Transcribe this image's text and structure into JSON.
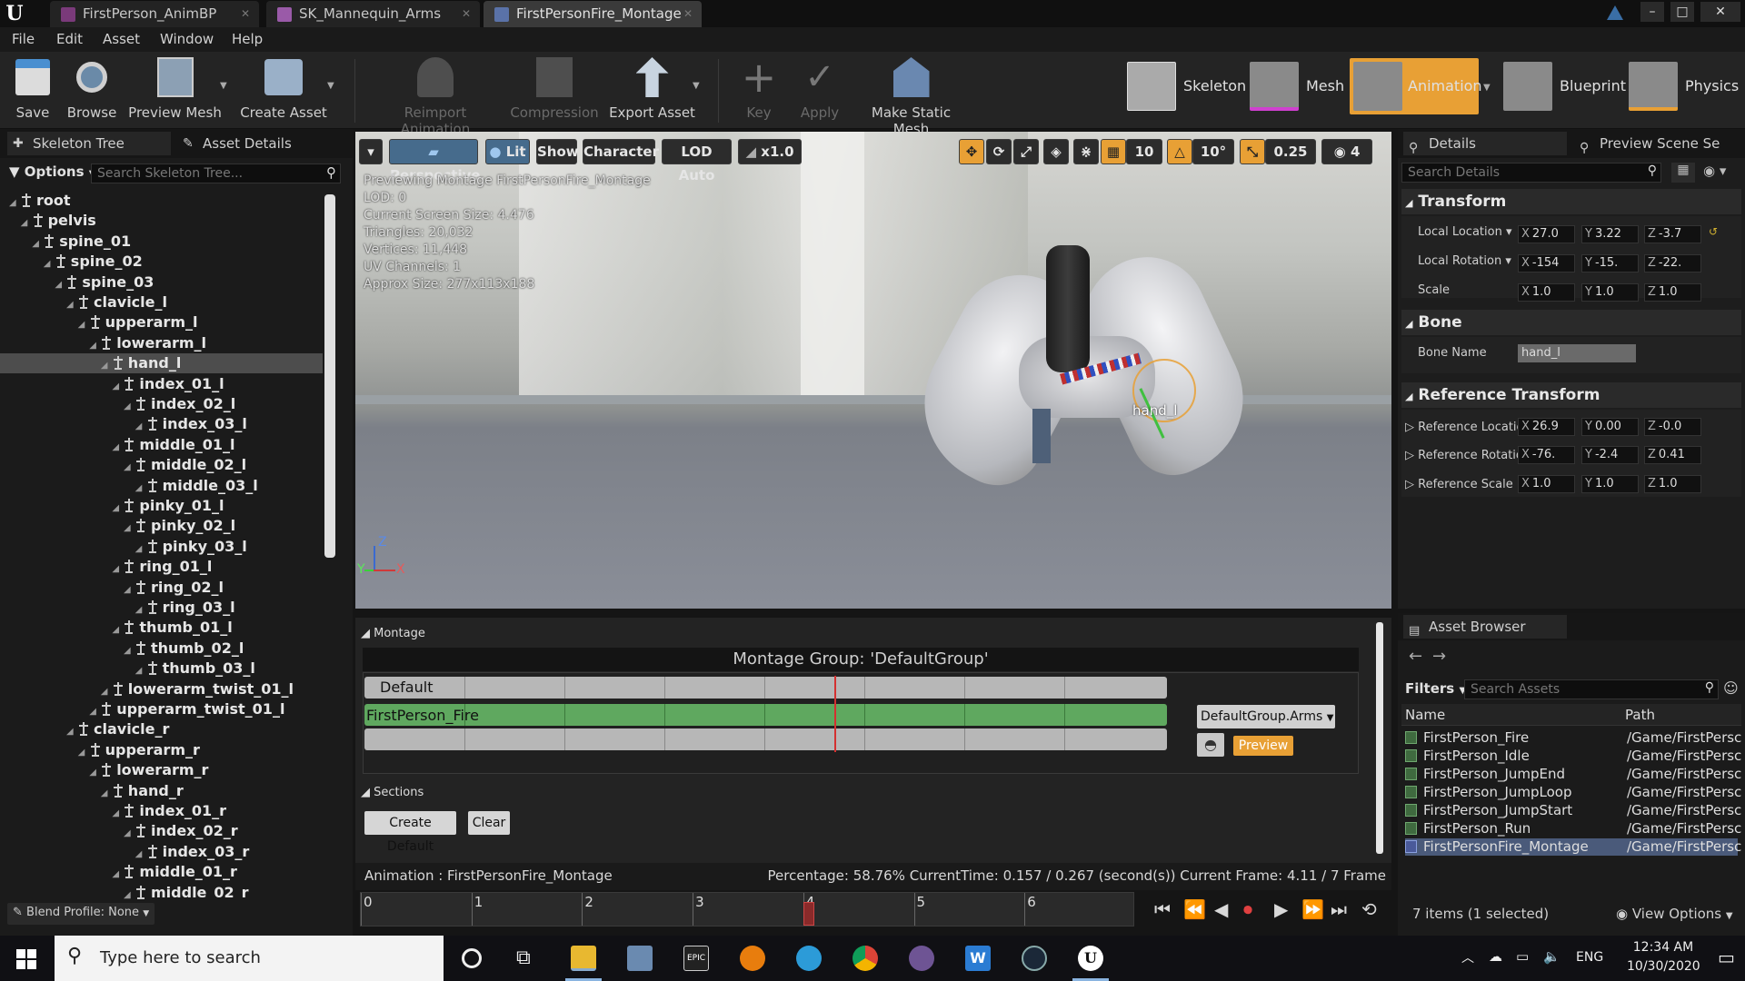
{
  "window": {
    "tabs": [
      {
        "label": "FirstPerson_AnimBP",
        "color": "#7a3a7a"
      },
      {
        "label": "SK_Mannequin_Arms",
        "color": "#9a5aa8"
      },
      {
        "label": "FirstPersonFire_Montage",
        "color": "#5a72a8"
      }
    ],
    "buttons": [
      "–",
      "□",
      "✕"
    ]
  },
  "menu": [
    "File",
    "Edit",
    "Asset",
    "Window",
    "Help"
  ],
  "toolbar": {
    "save": "Save",
    "browse": "Browse",
    "preview_mesh": "Preview Mesh",
    "create_asset": "Create Asset",
    "reimport": "Reimport Animation",
    "compression": "Compression",
    "export_asset": "Export Asset",
    "key": "Key",
    "apply": "Apply",
    "make_static_mesh": "Make Static Mesh",
    "modes": [
      "Skeleton",
      "Mesh",
      "Animation",
      "Blueprint",
      "Physics"
    ]
  },
  "left_panel": {
    "tabs": [
      "Skeleton Tree",
      "Asset Details"
    ],
    "options_label": "Options",
    "search_placeholder": "Search Skeleton Tree...",
    "selected_bone": "hand_l",
    "tree": [
      {
        "name": "root",
        "depth": 0
      },
      {
        "name": "pelvis",
        "depth": 1
      },
      {
        "name": "spine_01",
        "depth": 2
      },
      {
        "name": "spine_02",
        "depth": 3
      },
      {
        "name": "spine_03",
        "depth": 4
      },
      {
        "name": "clavicle_l",
        "depth": 5
      },
      {
        "name": "upperarm_l",
        "depth": 6
      },
      {
        "name": "lowerarm_l",
        "depth": 7
      },
      {
        "name": "hand_l",
        "depth": 8
      },
      {
        "name": "index_01_l",
        "depth": 9
      },
      {
        "name": "index_02_l",
        "depth": 10
      },
      {
        "name": "index_03_l",
        "depth": 11
      },
      {
        "name": "middle_01_l",
        "depth": 9
      },
      {
        "name": "middle_02_l",
        "depth": 10
      },
      {
        "name": "middle_03_l",
        "depth": 11
      },
      {
        "name": "pinky_01_l",
        "depth": 9
      },
      {
        "name": "pinky_02_l",
        "depth": 10
      },
      {
        "name": "pinky_03_l",
        "depth": 11
      },
      {
        "name": "ring_01_l",
        "depth": 9
      },
      {
        "name": "ring_02_l",
        "depth": 10
      },
      {
        "name": "ring_03_l",
        "depth": 11
      },
      {
        "name": "thumb_01_l",
        "depth": 9
      },
      {
        "name": "thumb_02_l",
        "depth": 10
      },
      {
        "name": "thumb_03_l",
        "depth": 11
      },
      {
        "name": "lowerarm_twist_01_l",
        "depth": 8
      },
      {
        "name": "upperarm_twist_01_l",
        "depth": 7
      },
      {
        "name": "clavicle_r",
        "depth": 5
      },
      {
        "name": "upperarm_r",
        "depth": 6
      },
      {
        "name": "lowerarm_r",
        "depth": 7
      },
      {
        "name": "hand_r",
        "depth": 8
      },
      {
        "name": "index_01_r",
        "depth": 9
      },
      {
        "name": "index_02_r",
        "depth": 10
      },
      {
        "name": "index_03_r",
        "depth": 11
      },
      {
        "name": "middle_01_r",
        "depth": 9
      },
      {
        "name": "middle_02_r",
        "depth": 10
      }
    ],
    "blend_profile": "Blend Profile: None"
  },
  "viewport": {
    "perspective": "Perspective",
    "lit": "Lit",
    "show": "Show",
    "character": "Character",
    "lod": "LOD Auto",
    "speed": "x1.0",
    "grid_snap": "10",
    "rot_snap": "10°",
    "scale_snap": "0.25",
    "cam_speed": "4",
    "stats": [
      "Previewing Montage FirstPersonFire_Montage",
      "LOD: 0",
      "Current Screen Size: 4.476",
      "Triangles: 20,032",
      "Vertices: 11,448",
      "UV Channels: 1",
      "Approx Size: 277x113x188"
    ],
    "bone_label": "hand_l",
    "axis_z": "Z",
    "axis_x": "X",
    "axis_y": "Y"
  },
  "montage": {
    "header": "Montage",
    "group_title": "Montage Group: 'DefaultGroup'",
    "default_label": "Default",
    "clip_label": "FirstPerson_Fire",
    "slot_dropdown": "DefaultGroup.Arms",
    "preview": "Preview",
    "sections_header": "Sections",
    "create_default": "Create Default",
    "clear": "Clear",
    "status_animation": "Animation :  FirstPersonFire_Montage",
    "status_right": "Percentage:  58.76%  CurrentTime:  0.157 / 0.267 (second(s))  Current Frame:  4.11 / 7 Frame",
    "timeline_ticks": [
      "0",
      "1",
      "2",
      "3",
      "4",
      "5",
      "6"
    ],
    "current_frame": 4.11,
    "total_frames": 7
  },
  "details": {
    "tabs": [
      "Details",
      "Preview Scene Se"
    ],
    "search_placeholder": "Search Details",
    "transform_header": "Transform",
    "local_location": "Local Location",
    "local_location_vals": [
      "27.0",
      "3.22",
      "-3.7"
    ],
    "local_rotation": "Local Rotation",
    "local_rotation_vals": [
      "-154",
      "-15.",
      "-22."
    ],
    "scale": "Scale",
    "scale_vals": [
      "1.0",
      "1.0",
      "1.0"
    ],
    "bone_header": "Bone",
    "bone_name_label": "Bone Name",
    "bone_name_value": "hand_l",
    "ref_header": "Reference Transform",
    "ref_location": "Reference Locatic",
    "ref_location_vals": [
      "26.9",
      "0.00",
      "-0.0"
    ],
    "ref_rotation": "Reference Rotatio",
    "ref_rotation_vals": [
      "-76.",
      "-2.4",
      "0.41"
    ],
    "ref_scale": "Reference Scale",
    "ref_scale_vals": [
      "1.0",
      "1.0",
      "1.0"
    ]
  },
  "asset_browser": {
    "title": "Asset Browser",
    "filters": "Filters",
    "search_placeholder": "Search Assets",
    "col_name": "Name",
    "col_path": "Path",
    "items": [
      {
        "name": "FirstPerson_Fire",
        "path": "/Game/FirstPersc"
      },
      {
        "name": "FirstPerson_Idle",
        "path": "/Game/FirstPersc"
      },
      {
        "name": "FirstPerson_JumpEnd",
        "path": "/Game/FirstPersc"
      },
      {
        "name": "FirstPerson_JumpLoop",
        "path": "/Game/FirstPersc"
      },
      {
        "name": "FirstPerson_JumpStart",
        "path": "/Game/FirstPersc"
      },
      {
        "name": "FirstPerson_Run",
        "path": "/Game/FirstPersc"
      },
      {
        "name": "FirstPersonFire_Montage",
        "path": "/Game/FirstPersc"
      }
    ],
    "count": "7 items (1 selected)",
    "view_options": "View Options"
  },
  "taskbar": {
    "search_placeholder": "Type here to search",
    "lang": "ENG",
    "time": "12:34 AM",
    "date": "10/30/2020"
  },
  "colors": {
    "accent_orange": "#e8a035",
    "selection_blue": "#3c5a80",
    "clip_green": "#5fa85f"
  }
}
